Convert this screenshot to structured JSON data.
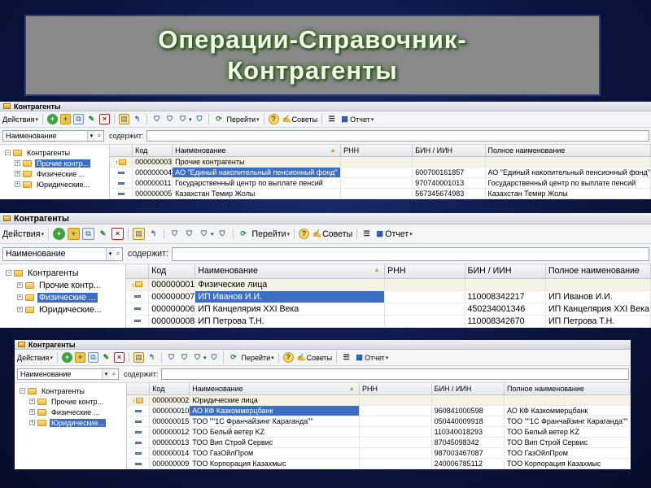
{
  "slide": {
    "title": "Операции-Справочник-\nКонтрагенты"
  },
  "colors": {
    "background": "#0b1642",
    "title_panel": "#8a8a8a",
    "title_text": "#f3f7ee",
    "selection": "#3c6ec4"
  },
  "window": {
    "title": "Контрагенты",
    "toolbar": {
      "actions_label": "Действия",
      "goto_label": "Перейти",
      "tips_label": "Советы",
      "report_label": "Отчет",
      "icons": [
        "add-icon",
        "add-folder-icon",
        "copy-icon",
        "edit-icon",
        "delete-icon",
        "hierarchy-icon",
        "level-up-icon",
        "filter-icon",
        "filter-list-icon",
        "filter-clear-icon",
        "refresh-icon",
        "help-icon",
        "tips-icon",
        "list-settings-icon",
        "report-icon"
      ]
    },
    "search": {
      "field_value": "Наименование",
      "contains_label": "содержит:",
      "contains_value": ""
    },
    "tree_root": "Контрагенты",
    "tree_items": [
      "Прочие контрагенты",
      "Физические лица",
      "Юридические лица"
    ],
    "tree_items_short": [
      "Прочие контр...",
      "Физические ...",
      "Юридические..."
    ],
    "columns": [
      "Код",
      "Наименование",
      "РНН",
      "БИН / ИИН",
      "Полное наименование"
    ]
  },
  "panels": [
    {
      "selected_tree_index": 0,
      "group_row": {
        "code": "000000003",
        "name": "Прочие контрагенты"
      },
      "rows": [
        {
          "code": "000000004",
          "name": "АО \"Единый накопительный пенсионный фонд\"",
          "rnn": "",
          "bin": "600700161857",
          "full_name": "АО \"Единый накопительный пенсионный фонд\"",
          "selected": true
        },
        {
          "code": "000000011",
          "name": "Государственный центр по выплате пенсий",
          "rnn": "",
          "bin": "970740001013",
          "full_name": "Государственный центр по выплате пенсий",
          "selected": false
        },
        {
          "code": "000000005",
          "name": "Казахстан Темир Жолы",
          "rnn": "",
          "bin": "567345674983",
          "full_name": "Казахстан Темир Жолы",
          "selected": false
        }
      ]
    },
    {
      "selected_tree_index": 1,
      "group_row": {
        "code": "000000001",
        "name": "Физические лица"
      },
      "rows": [
        {
          "code": "000000007",
          "name": "ИП Иванов И.И.",
          "rnn": "",
          "bin": "110008342217",
          "full_name": "ИП Иванов И.И.",
          "selected": true
        },
        {
          "code": "000000006",
          "name": "ИП Канцелярия XXI Века",
          "rnn": "",
          "bin": "450234001346",
          "full_name": "ИП Канцелярия XXI Века",
          "selected": false
        },
        {
          "code": "000000008",
          "name": "ИП Петрова Т.Н.",
          "rnn": "",
          "bin": "110008342670",
          "full_name": "ИП Петрова Т.Н.",
          "selected": false
        }
      ]
    },
    {
      "selected_tree_index": 2,
      "group_row": {
        "code": "000000002",
        "name": "Юридические лица"
      },
      "rows": [
        {
          "code": "000000010",
          "name": "АО КФ Казкоммерцбанк",
          "rnn": "",
          "bin": "960841000598",
          "full_name": "АО КФ Казкоммерцбанк",
          "selected": true
        },
        {
          "code": "000000015",
          "name": "ТОО \"\"1С Франчайзинг Караганда\"\"",
          "rnn": "",
          "bin": "050440009918",
          "full_name": "ТОО \"\"1С Франчайзинг Караганда\"\"",
          "selected": false
        },
        {
          "code": "000000012",
          "name": "ТОО Белый ветер KZ",
          "rnn": "",
          "bin": "110340018293",
          "full_name": "ТОО Белый ветер KZ",
          "selected": false
        },
        {
          "code": "000000013",
          "name": "ТОО Вип Строй Сервис",
          "rnn": "",
          "bin": "87045098342",
          "full_name": "ТОО Вип Строй Сервис",
          "selected": false
        },
        {
          "code": "000000014",
          "name": "ТОО ГазОйлПром",
          "rnn": "",
          "bin": "987003467087",
          "full_name": "ТОО ГазОйлПром",
          "selected": false
        },
        {
          "code": "000000009",
          "name": "ТОО Корпорация Казахмыс",
          "rnn": "",
          "bin": "240006785112",
          "full_name": "ТОО Корпорация Казахмыс",
          "selected": false
        }
      ]
    }
  ]
}
